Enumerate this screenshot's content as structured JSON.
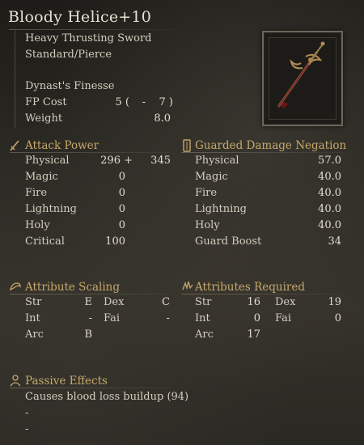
{
  "weapon": {
    "name": "Bloody Helice+10",
    "class": "Heavy Thrusting Sword",
    "damage_type": "Standard/Pierce",
    "skill": "Dynast's Finesse",
    "fp_label": "FP Cost",
    "fp_1": "5 (",
    "fp_dash": "-",
    "fp_2": "7 )",
    "weight_label": "Weight",
    "weight": "8.0"
  },
  "attack": {
    "heading": "Attack Power",
    "rows": [
      {
        "label": "Physical",
        "value": "296 +",
        "bonus": "345"
      },
      {
        "label": "Magic",
        "value": "0"
      },
      {
        "label": "Fire",
        "value": "0"
      },
      {
        "label": "Lightning",
        "value": "0"
      },
      {
        "label": "Holy",
        "value": "0"
      },
      {
        "label": "Critical",
        "value": "100"
      }
    ]
  },
  "guard": {
    "heading": "Guarded Damage Negation",
    "rows": [
      {
        "label": "Physical",
        "value": "57.0"
      },
      {
        "label": "Magic",
        "value": "40.0"
      },
      {
        "label": "Fire",
        "value": "40.0"
      },
      {
        "label": "Lightning",
        "value": "40.0"
      },
      {
        "label": "Holy",
        "value": "40.0"
      },
      {
        "label": "Guard Boost",
        "value": "34"
      }
    ]
  },
  "scaling": {
    "heading": "Attribute Scaling",
    "str_label": "Str",
    "str": "E",
    "dex_label": "Dex",
    "dex": "C",
    "int_label": "Int",
    "int": "-",
    "fai_label": "Fai",
    "fai": "-",
    "arc_label": "Arc",
    "arc": "B"
  },
  "required": {
    "heading": "Attributes Required",
    "str_label": "Str",
    "str": "16",
    "dex_label": "Dex",
    "dex": "19",
    "int_label": "Int",
    "int": "0",
    "fai_label": "Fai",
    "fai": "0",
    "arc_label": "Arc",
    "arc": "17"
  },
  "passive": {
    "heading": "Passive Effects",
    "effect_1": "Causes blood loss buildup (94)",
    "effect_2": "-",
    "effect_3": "-"
  },
  "colors": {
    "accent": "#c6a86b",
    "text": "#d8d3c4",
    "blood": "#8e1e1a"
  }
}
